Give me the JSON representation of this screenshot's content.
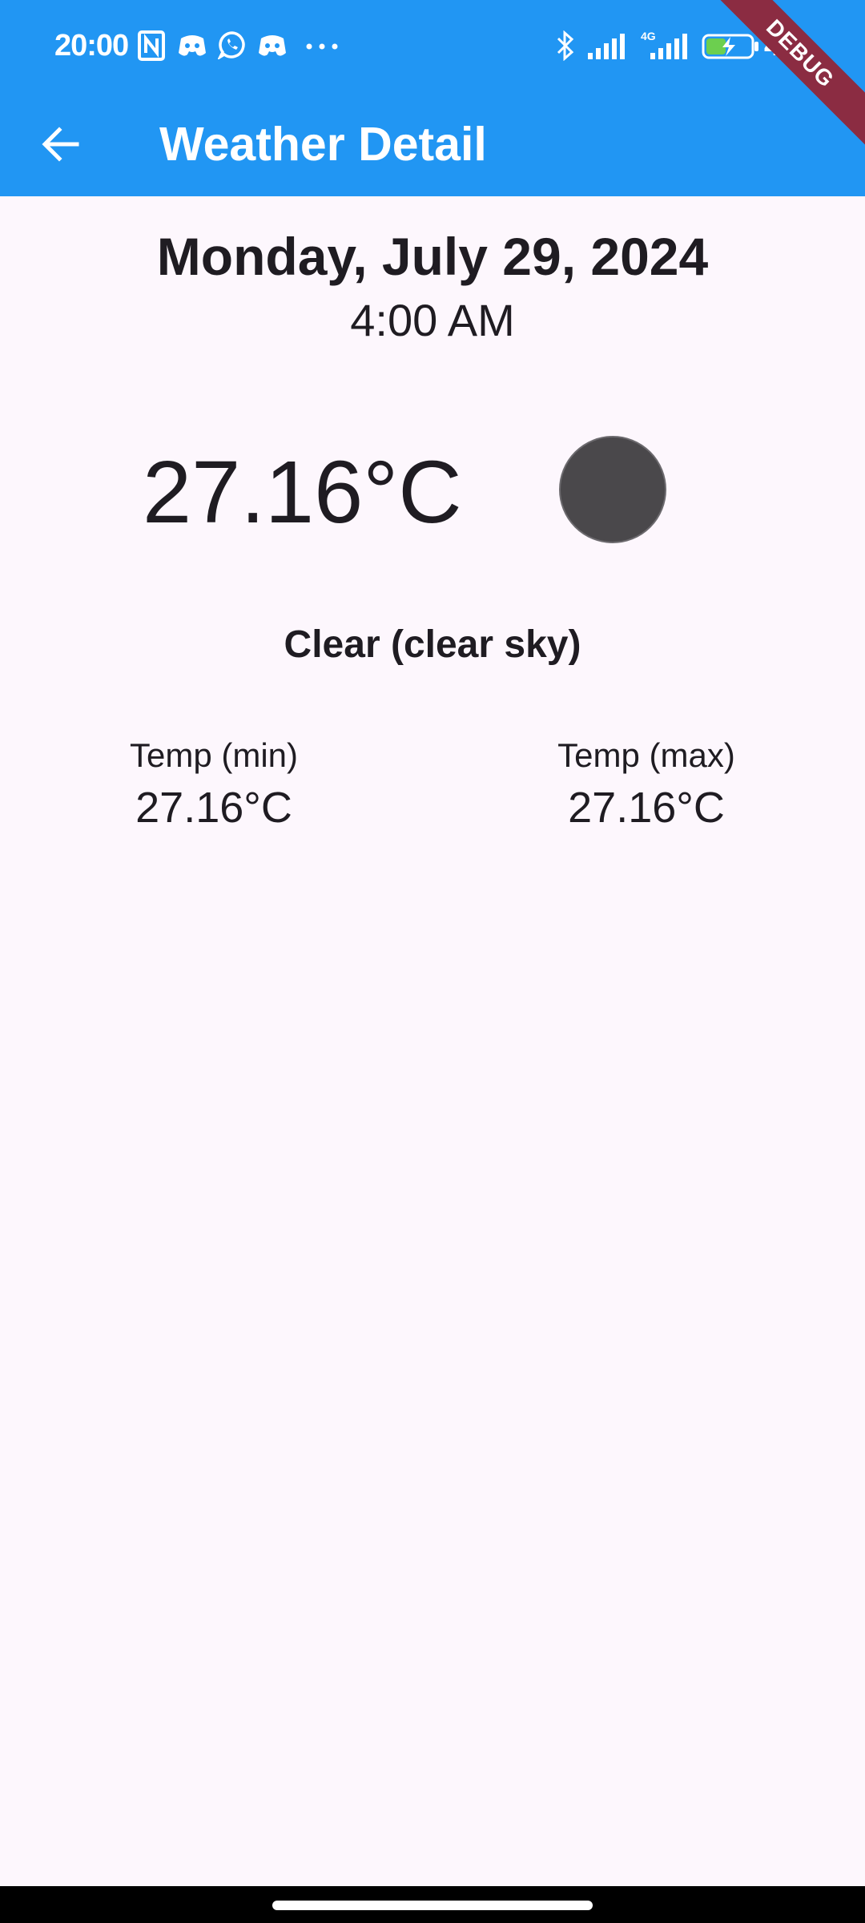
{
  "status_bar": {
    "time": "20:00",
    "battery": "40",
    "icons": [
      "nfc-icon",
      "discord-icon",
      "whatsapp-icon",
      "discord-icon",
      "more-dots-icon",
      "bluetooth-icon",
      "signal-icon",
      "signal-4g-icon",
      "battery-charging-icon"
    ]
  },
  "app_bar": {
    "title": "Weather Detail",
    "back_icon": "arrow-back-icon",
    "debug_banner": "DEBUG",
    "color": "#2196f3"
  },
  "weather": {
    "date": "Monday, July 29, 2024",
    "time": "4:00 AM",
    "temperature": "27.16°C",
    "condition": "Clear (clear sky)",
    "temp_min_label": "Temp (min)",
    "temp_min": "27.16°C",
    "temp_max_label": "Temp (max)",
    "temp_max": "27.16°C",
    "icon": "weather-placeholder-icon"
  },
  "colors": {
    "background": "#fdf7fd",
    "text": "#1f1c22",
    "debug": "#8b2c42"
  }
}
